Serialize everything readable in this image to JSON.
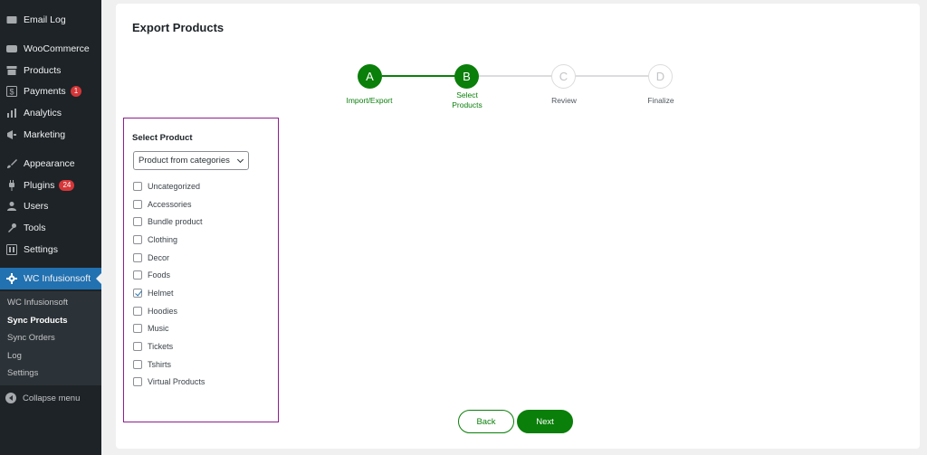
{
  "sidebar": {
    "items": [
      {
        "label": "Email Log",
        "icon": "envelope-icon"
      },
      {
        "label": "WooCommerce",
        "icon": "woo-icon"
      },
      {
        "label": "Products",
        "icon": "archive-icon"
      },
      {
        "label": "Payments",
        "icon": "dollar-icon",
        "badge": "1"
      },
      {
        "label": "Analytics",
        "icon": "bar-chart-icon"
      },
      {
        "label": "Marketing",
        "icon": "megaphone-icon"
      },
      {
        "label": "Appearance",
        "icon": "brush-icon"
      },
      {
        "label": "Plugins",
        "icon": "plug-icon",
        "badge": "24"
      },
      {
        "label": "Users",
        "icon": "user-icon"
      },
      {
        "label": "Tools",
        "icon": "wrench-icon"
      },
      {
        "label": "Settings",
        "icon": "sliders-icon"
      },
      {
        "label": "WC Infusionsoft",
        "icon": "gear-icon"
      }
    ],
    "submenu": [
      "WC Infusionsoft",
      "Sync Products",
      "Sync Orders",
      "Log",
      "Settings"
    ],
    "collapse_label": "Collapse menu"
  },
  "page": {
    "title": "Export Products"
  },
  "stepper": [
    {
      "letter": "A",
      "label": "Import/Export",
      "state": "done"
    },
    {
      "letter": "B",
      "label": "Select Products",
      "state": "done"
    },
    {
      "letter": "C",
      "label": "Review",
      "state": "todo"
    },
    {
      "letter": "D",
      "label": "Finalize",
      "state": "todo"
    }
  ],
  "select_product": {
    "title": "Select Product",
    "dropdown_value": "Product from categories",
    "categories": [
      {
        "label": "Uncategorized",
        "checked": false
      },
      {
        "label": "Accessories",
        "checked": false
      },
      {
        "label": "Bundle product",
        "checked": false
      },
      {
        "label": "Clothing",
        "checked": false
      },
      {
        "label": "Decor",
        "checked": false
      },
      {
        "label": "Foods",
        "checked": false
      },
      {
        "label": "Helmet",
        "checked": true
      },
      {
        "label": "Hoodies",
        "checked": false
      },
      {
        "label": "Music",
        "checked": false
      },
      {
        "label": "Tickets",
        "checked": false
      },
      {
        "label": "Tshirts",
        "checked": false
      },
      {
        "label": "Virtual Products",
        "checked": false
      }
    ]
  },
  "buttons": {
    "back": "Back",
    "next": "Next"
  },
  "colors": {
    "accent_green": "#0a7f0a",
    "admin_blue": "#2271b1",
    "sidebar_bg": "#1d2327",
    "highlight_border": "#8e1e8f"
  }
}
